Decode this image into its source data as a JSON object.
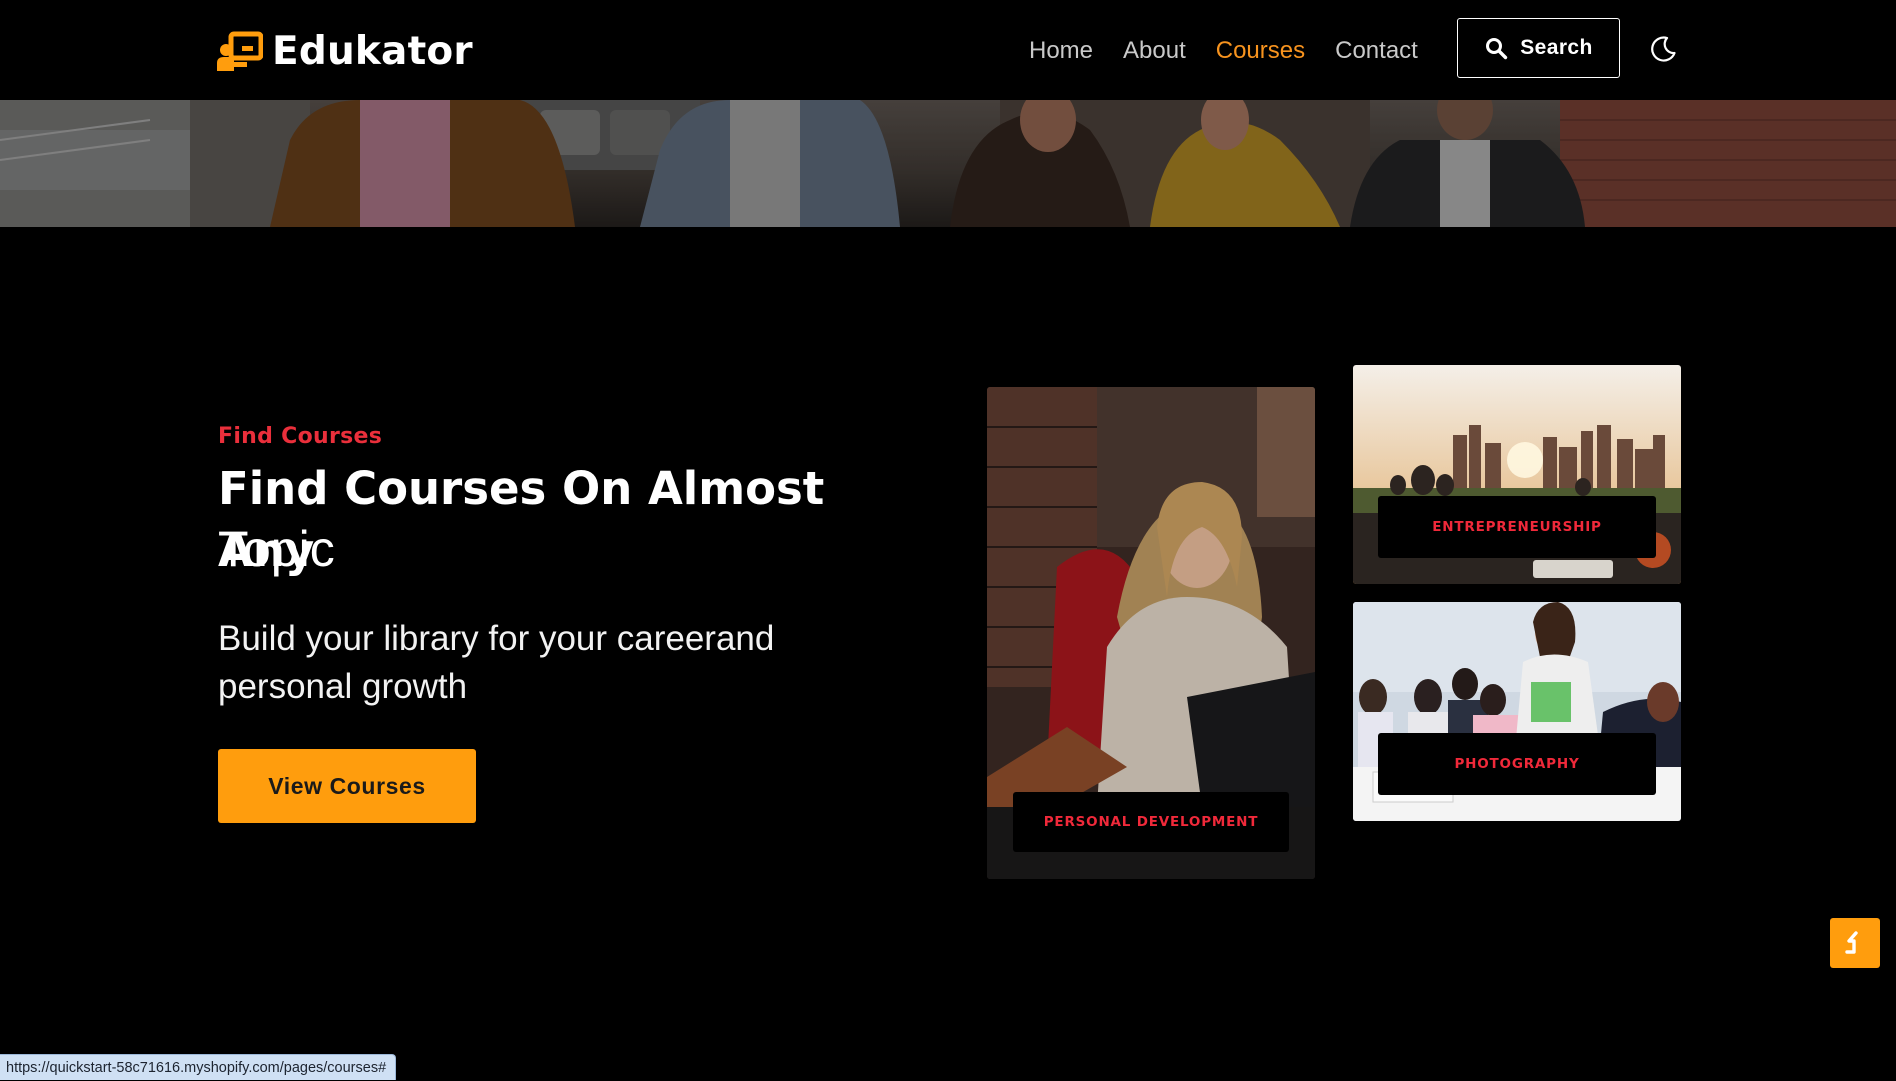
{
  "brand": {
    "name": "Edukator",
    "accent_color": "#ff9d0d",
    "icon": "teacher-board-icon"
  },
  "nav": {
    "items": [
      {
        "label": "Home",
        "active": false
      },
      {
        "label": "About",
        "active": false
      },
      {
        "label": "Courses",
        "active": true
      },
      {
        "label": "Contact",
        "active": false
      }
    ],
    "search_label": "Search",
    "theme_toggle_icon": "moon-icon"
  },
  "hero": {
    "eyebrow": "Find Courses",
    "headline_bold": "Find Courses On Almost Any",
    "headline_regular": "Topic",
    "subtext": "Build your library for your careerand personal growth",
    "cta_label": "View Courses"
  },
  "categories": [
    {
      "label": "PERSONAL DEVELOPMENT"
    },
    {
      "label": "ENTREPRENEURSHIP"
    },
    {
      "label": "PHOTOGRAPHY"
    }
  ],
  "back_to_top_icon": "arrow-up-icon",
  "status_url": "https://quickstart-58c71616.myshopify.com/pages/courses#",
  "colors": {
    "eyebrow": "#ea2f3b",
    "active_nav": "#f7931e",
    "tag_text": "#f0293a"
  }
}
